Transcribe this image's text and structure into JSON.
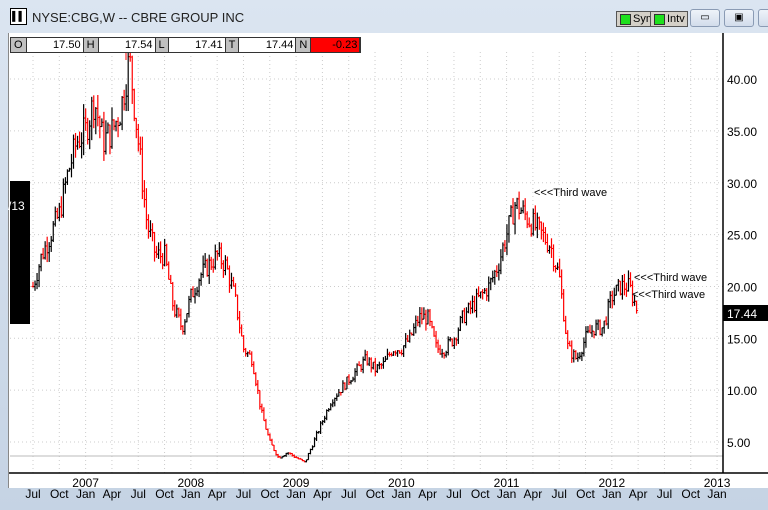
{
  "window": {
    "title": "NYSE:CBG,W -- CBRE GROUP INC",
    "sym_label": "Sym",
    "intv_label": "Intv",
    "minimize": "minimize-icon",
    "restore": "restore-icon"
  },
  "ohlc": {
    "o_label": "O",
    "o": "17.50",
    "h_label": "H",
    "h": "17.54",
    "l_label": "L",
    "l": "17.41",
    "t_label": "T",
    "t": "17.44",
    "n_label": "N",
    "n": "-0.23"
  },
  "left_tag": "/13",
  "last_price": "17.44",
  "colors": {
    "up": "#000000",
    "down": "#ff0000",
    "change_bg": "#ff0000"
  },
  "chart_data": {
    "type": "ohlc",
    "interval": "weekly",
    "ylim": [
      2,
      45
    ],
    "yticks": [
      "5.00",
      "10.00",
      "15.00",
      "20.00",
      "25.00",
      "30.00",
      "35.00",
      "40.00"
    ],
    "years": [
      "2007",
      "2008",
      "2009",
      "2010",
      "2011",
      "2012",
      "2013"
    ],
    "month_ticks": [
      "Jul",
      "Oct",
      "Jan",
      "Apr",
      "Jul",
      "Oct",
      "Jan",
      "Apr",
      "Jul",
      "Oct",
      "Jan",
      "Apr",
      "Jul",
      "Oct",
      "Jan",
      "Apr",
      "Jul",
      "Oct",
      "Jan",
      "Apr",
      "Jul",
      "Oct",
      "Jan",
      "Apr",
      "Jul",
      "Oct",
      "Jan"
    ],
    "start": "2006-07",
    "monthly_close": [
      20,
      23,
      25,
      27,
      31,
      34,
      35,
      38,
      34,
      35,
      37,
      42,
      34,
      26,
      23,
      23,
      18,
      16,
      19,
      21,
      22,
      23,
      22,
      19,
      14,
      13,
      8,
      5,
      3.5,
      4,
      3.5,
      3,
      5,
      7,
      9,
      10,
      11,
      12,
      13,
      12,
      12.5,
      14,
      14,
      15,
      17,
      17,
      14,
      14,
      15,
      17,
      18,
      19,
      20,
      22,
      25,
      28,
      27,
      26,
      25,
      24,
      21,
      14,
      13,
      15,
      16,
      16,
      19,
      20,
      20,
      17.44
    ],
    "annotations": [
      {
        "text": "<<<Third wave",
        "date": "2011-02",
        "price": 29.2
      },
      {
        "text": "<<<Third wave",
        "date": "2012-02",
        "price": 21
      },
      {
        "text": "<<<Third wave",
        "date": "2012-02",
        "price": 19.3
      }
    ]
  }
}
